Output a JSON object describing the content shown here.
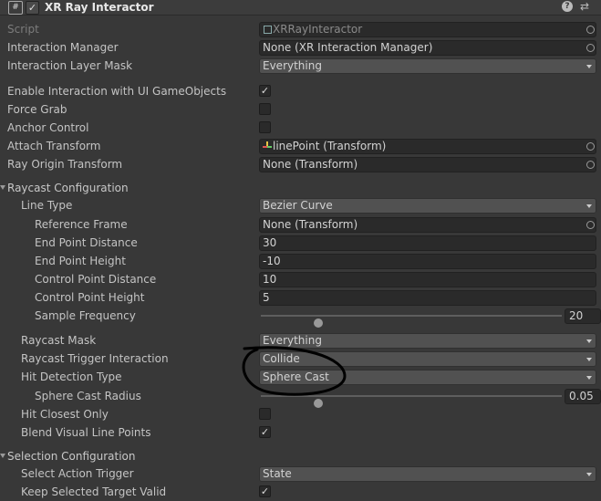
{
  "component": {
    "icon_text": "#",
    "enabled_mark": "✓",
    "title": "XR Ray Interactor",
    "help_glyph": "?",
    "preset_glyph": "⇄"
  },
  "rows": {
    "script": {
      "label": "Script",
      "value": "XRRayInteractor"
    },
    "interaction_manager": {
      "label": "Interaction Manager",
      "value": "None (XR Interaction Manager)"
    },
    "interaction_layer_mask": {
      "label": "Interaction Layer Mask",
      "value": "Everything"
    },
    "enable_ui": {
      "label": "Enable Interaction with UI GameObjects",
      "checked": true
    },
    "force_grab": {
      "label": "Force Grab",
      "checked": false
    },
    "anchor_control": {
      "label": "Anchor Control",
      "checked": false
    },
    "attach_transform": {
      "label": "Attach Transform",
      "value": "linePoint (Transform)"
    },
    "ray_origin_transform": {
      "label": "Ray Origin Transform",
      "value": "None (Transform)"
    },
    "raycast_configuration": {
      "label": "Raycast Configuration"
    },
    "line_type": {
      "label": "Line Type",
      "value": "Bezier Curve"
    },
    "reference_frame": {
      "label": "Reference Frame",
      "value": "None (Transform)"
    },
    "end_point_distance": {
      "label": "End Point Distance",
      "value": "30"
    },
    "end_point_height": {
      "label": "End Point Height",
      "value": "-10"
    },
    "control_point_distance": {
      "label": "Control Point Distance",
      "value": "10"
    },
    "control_point_height": {
      "label": "Control Point Height",
      "value": "5"
    },
    "sample_frequency": {
      "label": "Sample Frequency",
      "value": "20",
      "min": 2,
      "max": 100,
      "level": 0.19
    },
    "raycast_mask": {
      "label": "Raycast Mask",
      "value": "Everything"
    },
    "raycast_trigger_interaction": {
      "label": "Raycast Trigger Interaction",
      "value": "Collide"
    },
    "hit_detection_type": {
      "label": "Hit Detection Type",
      "value": "Sphere Cast"
    },
    "sphere_cast_radius": {
      "label": "Sphere Cast Radius",
      "value": "0.05",
      "min": 0,
      "max": 0.25,
      "level": 0.19
    },
    "hit_closest_only": {
      "label": "Hit Closest Only",
      "checked": false
    },
    "blend_visual_line_points": {
      "label": "Blend Visual Line Points",
      "checked": true
    },
    "selection_configuration": {
      "label": "Selection Configuration"
    },
    "select_action_trigger": {
      "label": "Select Action Trigger",
      "value": "State"
    },
    "keep_selected_target_valid": {
      "label": "Keep Selected Target Valid",
      "checked": true
    }
  },
  "colors": {
    "background": "#383838",
    "annotation_stroke": "#000000"
  }
}
